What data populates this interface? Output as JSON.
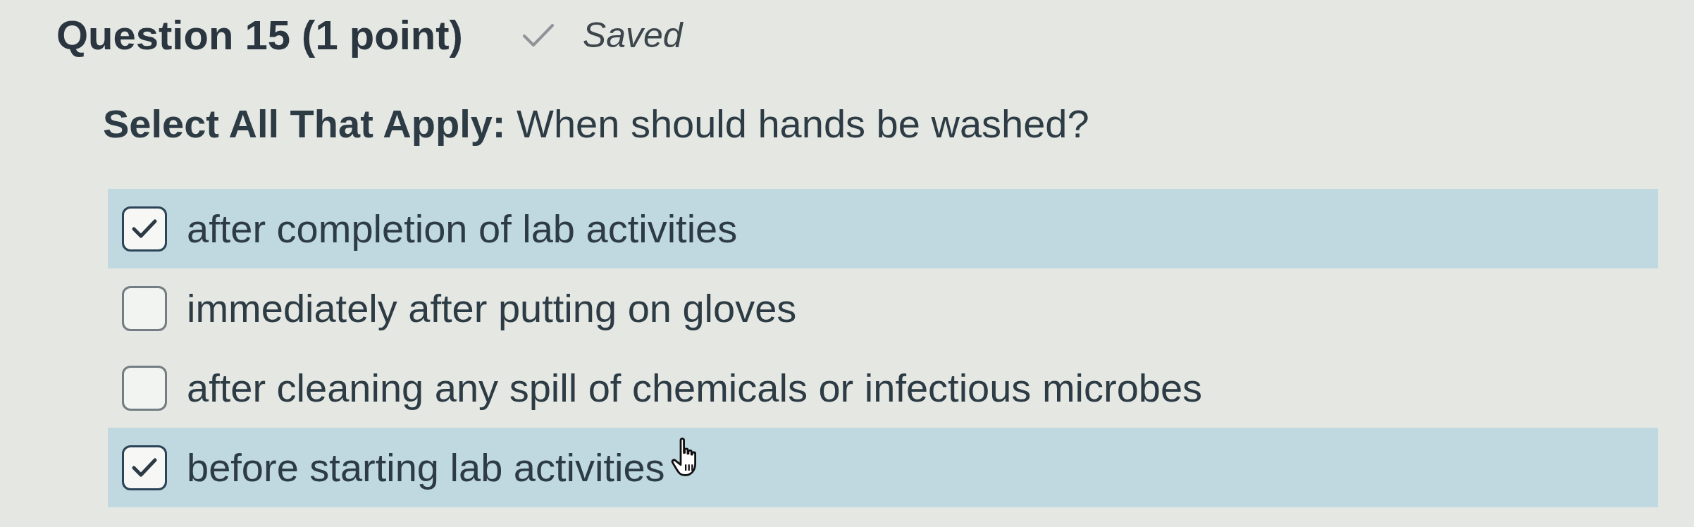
{
  "question": {
    "title": "Question 15 (1 point)",
    "save_status": "Saved"
  },
  "prompt": "**Select All That Apply:** When should hands be washed?",
  "options": [
    {
      "label": "after completion of lab activities",
      "checked": true,
      "hovered": false
    },
    {
      "label": "immediately after putting on gloves",
      "checked": false,
      "hovered": false
    },
    {
      "label": "after cleaning any spill of chemicals or infectious microbes",
      "checked": false,
      "hovered": false
    },
    {
      "label": "before starting lab activities",
      "checked": true,
      "hovered": true
    }
  ]
}
